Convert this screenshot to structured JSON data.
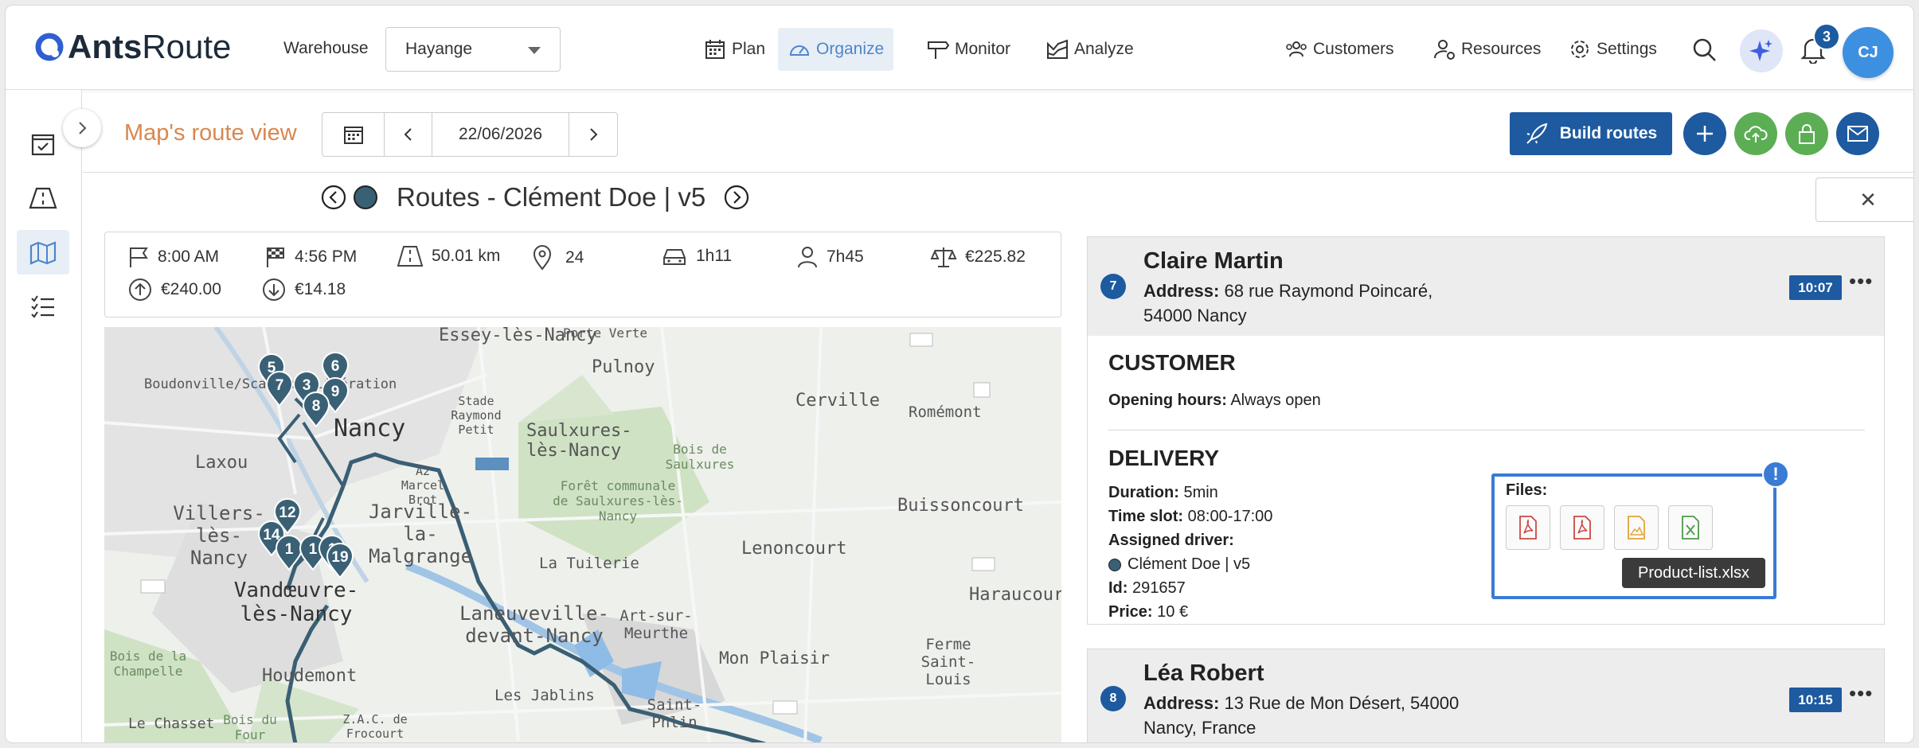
{
  "app": {
    "logo_bold": "Ants",
    "logo_light": "Route"
  },
  "header": {
    "warehouse_label": "Warehouse",
    "warehouse_value": "Hayange",
    "nav": [
      {
        "label": "Plan",
        "icon": "calendar-icon",
        "active": false
      },
      {
        "label": "Organize",
        "icon": "dashboard-icon",
        "active": true
      },
      {
        "label": "Monitor",
        "icon": "signpost-icon",
        "active": false
      },
      {
        "label": "Analyze",
        "icon": "chart-icon",
        "active": false
      }
    ],
    "right_nav": [
      {
        "label": "Customers",
        "icon": "users-icon"
      },
      {
        "label": "Resources",
        "icon": "user-gear-icon"
      },
      {
        "label": "Settings",
        "icon": "gear-icon"
      }
    ],
    "notifications_count": "3",
    "avatar_initials": "CJ"
  },
  "toolbar": {
    "page_title": "Map's route view",
    "date": "22/06/2026",
    "build_routes_label": "Build routes",
    "accent_color": "#1d5aa0"
  },
  "route": {
    "title": "Routes - Clément Doe | v5",
    "stats": {
      "start_time": "8:00 AM",
      "end_time": "4:56 PM",
      "distance": "50.01 km",
      "stops": "24",
      "drive_time": "1h11",
      "work_time": "7h45",
      "cost": "€225.82",
      "revenue_up": "€240.00",
      "revenue_down": "€14.18"
    }
  },
  "map": {
    "labels": [
      "Essey-lès-Nancy",
      "Porte Verte",
      "Pulnoy",
      "Boudonville/Scarpone/Libération",
      "Cerville",
      "Stade Raymond Petit",
      "Nancy",
      "Saulxures-lès-Nancy",
      "Romémont",
      "Laxou",
      "Bois de Saulxures",
      "A2 Marcel Brot",
      "Forêt communale de Saulxures-lès-Nancy",
      "Buissoncourt",
      "Villers-lès-Nancy",
      "Jarville-la-Malgrange",
      "La Tuilerie",
      "Lenoncourt",
      "Vandœuvre-lès-Nancy",
      "Haraucourt",
      "Laneuveville-devant-Nancy",
      "Art-sur-Meurthe",
      "Bois de la Champelle",
      "Houdemont",
      "Mon Plaisir",
      "Ferme Saint-Louis",
      "Les Jablins",
      "Saint-Phlin",
      "Le Chasset",
      "Bois du Four",
      "Z.A.C. de Frocourt"
    ],
    "pins": [
      "5",
      "7",
      "3",
      "6",
      "9",
      "8",
      "12",
      "14",
      "1",
      "1",
      "1",
      "19"
    ]
  },
  "stops": [
    {
      "number": "7",
      "name": "Claire Martin",
      "address_label": "Address:",
      "address": "68 rue Raymond Poincaré, 54000 Nancy",
      "time": "10:07",
      "customer_title": "CUSTOMER",
      "opening_label": "Opening hours:",
      "opening_value": "Always open",
      "delivery_title": "DELIVERY",
      "duration_label": "Duration:",
      "duration_value": "5min",
      "timeslot_label": "Time slot:",
      "timeslot_value": "08:00-17:00",
      "driver_label": "Assigned driver:",
      "driver_value": "Clément Doe | v5",
      "id_label": "Id:",
      "id_value": "291657",
      "price_label": "Price:",
      "price_value": "10 €",
      "files_label": "Files:",
      "tooltip": "Product-list.xlsx"
    },
    {
      "number": "8",
      "name": "Léa Robert",
      "address_label": "Address:",
      "address": "13 Rue de Mon Désert, 54000 Nancy, France",
      "time": "10:15"
    }
  ]
}
